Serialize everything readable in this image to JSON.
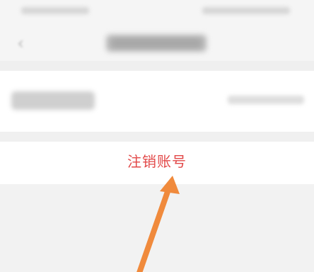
{
  "status_bar": {
    "left_text": "",
    "right_text": ""
  },
  "nav": {
    "back_icon": "chevron-left-icon",
    "title": ""
  },
  "account_phone_row": {
    "label": "",
    "value": ""
  },
  "cancel_account": {
    "label": "注销账号",
    "color": "#e24848"
  },
  "annotation": {
    "arrow_color": "#f08a3c"
  }
}
